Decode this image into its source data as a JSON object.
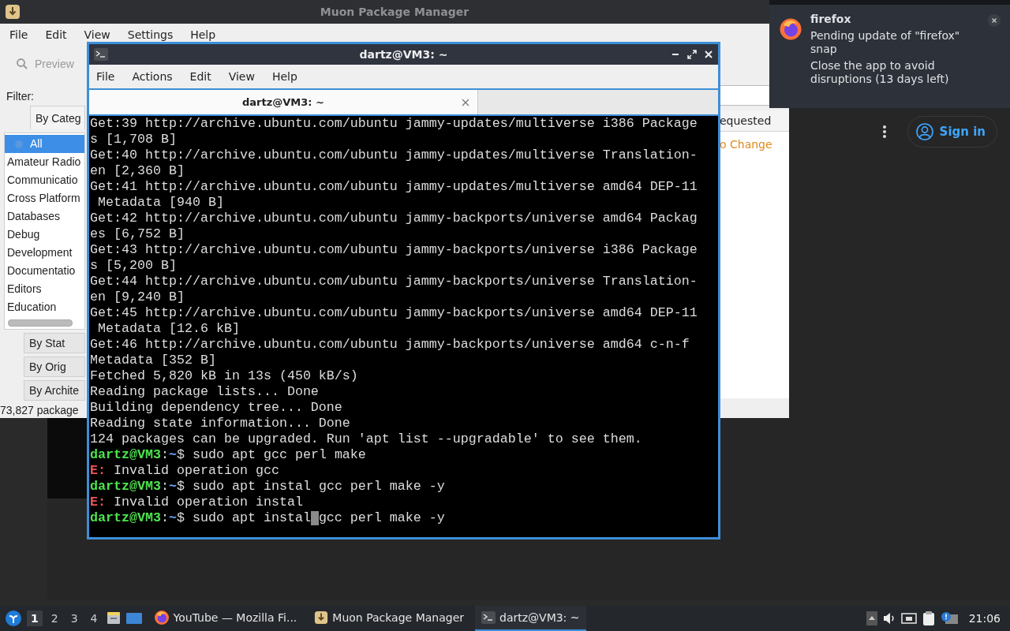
{
  "muon": {
    "title": "Muon Package Manager",
    "menu": [
      "File",
      "Edit",
      "View",
      "Settings",
      "Help"
    ],
    "toolbar": {
      "label": "Preview",
      "disabled": true
    },
    "filter_label": "Filter:",
    "filter_tabs": [
      {
        "label": "By Categ",
        "selected": true
      },
      {
        "label": "By Stat",
        "selected": false
      },
      {
        "label": "By Orig",
        "selected": false
      },
      {
        "label": "By Archite",
        "selected": false
      }
    ],
    "categories": [
      {
        "label": "All",
        "selected": true
      },
      {
        "label": "Amateur Radio",
        "selected": false
      },
      {
        "label": "Communicatio",
        "selected": false
      },
      {
        "label": "Cross Platform",
        "selected": false
      },
      {
        "label": "Databases",
        "selected": false
      },
      {
        "label": "Debug",
        "selected": false
      },
      {
        "label": "Development",
        "selected": false
      },
      {
        "label": "Documentatio",
        "selected": false
      },
      {
        "label": "Editors",
        "selected": false
      },
      {
        "label": "Education",
        "selected": false
      }
    ],
    "status": "73,827 package",
    "column_header": "equested",
    "cell": "o Change"
  },
  "terminal": {
    "title": "dartz@VM3: ~",
    "menu": [
      "File",
      "Actions",
      "Edit",
      "View",
      "Help"
    ],
    "tabs": [
      {
        "label": "dartz@VM3: ~",
        "selected": true
      }
    ],
    "lines": [
      {
        "kind": "output",
        "text": "Get:39 http://archive.ubuntu.com/ubuntu jammy-updates/multiverse i386 Package"
      },
      {
        "kind": "output",
        "text": "s [1,708 B]"
      },
      {
        "kind": "output",
        "text": "Get:40 http://archive.ubuntu.com/ubuntu jammy-updates/multiverse Translation-"
      },
      {
        "kind": "output",
        "text": "en [2,360 B]"
      },
      {
        "kind": "output",
        "text": "Get:41 http://archive.ubuntu.com/ubuntu jammy-updates/multiverse amd64 DEP-11"
      },
      {
        "kind": "output",
        "text": " Metadata [940 B]"
      },
      {
        "kind": "output",
        "text": "Get:42 http://archive.ubuntu.com/ubuntu jammy-backports/universe amd64 Packag"
      },
      {
        "kind": "output",
        "text": "es [6,752 B]"
      },
      {
        "kind": "output",
        "text": "Get:43 http://archive.ubuntu.com/ubuntu jammy-backports/universe i386 Package"
      },
      {
        "kind": "output",
        "text": "s [5,200 B]"
      },
      {
        "kind": "output",
        "text": "Get:44 http://archive.ubuntu.com/ubuntu jammy-backports/universe Translation-"
      },
      {
        "kind": "output",
        "text": "en [9,240 B]"
      },
      {
        "kind": "output",
        "text": "Get:45 http://archive.ubuntu.com/ubuntu jammy-backports/universe amd64 DEP-11"
      },
      {
        "kind": "output",
        "text": " Metadata [12.6 kB]"
      },
      {
        "kind": "output",
        "text": "Get:46 http://archive.ubuntu.com/ubuntu jammy-backports/universe amd64 c-n-f"
      },
      {
        "kind": "output",
        "text": "Metadata [352 B]"
      },
      {
        "kind": "output",
        "text": "Fetched 5,820 kB in 13s (450 kB/s)"
      },
      {
        "kind": "output",
        "text": "Reading package lists... Done"
      },
      {
        "kind": "output",
        "text": "Building dependency tree... Done"
      },
      {
        "kind": "output",
        "text": "Reading state information... Done"
      },
      {
        "kind": "output",
        "text": "124 packages can be upgraded. Run 'apt list --upgradable' to see them."
      },
      {
        "kind": "prompt",
        "user": "dartz@VM3",
        "sep": ":",
        "path": "~",
        "sign": "$",
        "command": "sudo apt gcc perl make"
      },
      {
        "kind": "error",
        "tag": "E:",
        "message": "Invalid operation gcc"
      },
      {
        "kind": "prompt",
        "user": "dartz@VM3",
        "sep": ":",
        "path": "~",
        "sign": "$",
        "command": "sudo apt instal gcc perl make -y"
      },
      {
        "kind": "error",
        "tag": "E:",
        "message": "Invalid operation instal"
      },
      {
        "kind": "prompt",
        "user": "dartz@VM3",
        "sep": ":",
        "path": "~",
        "sign": "$",
        "command": "sudo apt instal",
        "cursor": true,
        "after_cursor": "gcc perl make -y"
      }
    ]
  },
  "notification": {
    "app": "firefox",
    "message": "Pending update of \"firefox\" snap",
    "detail": "Close the app to avoid disruptions (13 days left)"
  },
  "browser": {
    "sign_in": "Sign in"
  },
  "taskbar": {
    "workspaces": [
      {
        "label": "1",
        "selected": true
      },
      {
        "label": "2",
        "selected": false
      },
      {
        "label": "3",
        "selected": false
      },
      {
        "label": "4",
        "selected": false
      }
    ],
    "tasks": [
      {
        "kind": "firefox",
        "label": "YouTube — Mozilla Fi...",
        "selected": false
      },
      {
        "kind": "package",
        "label": "Muon Package Manager",
        "selected": false
      },
      {
        "kind": "terminal",
        "label": "dartz@VM3: ~",
        "selected": true
      }
    ],
    "clock": "21:06"
  }
}
